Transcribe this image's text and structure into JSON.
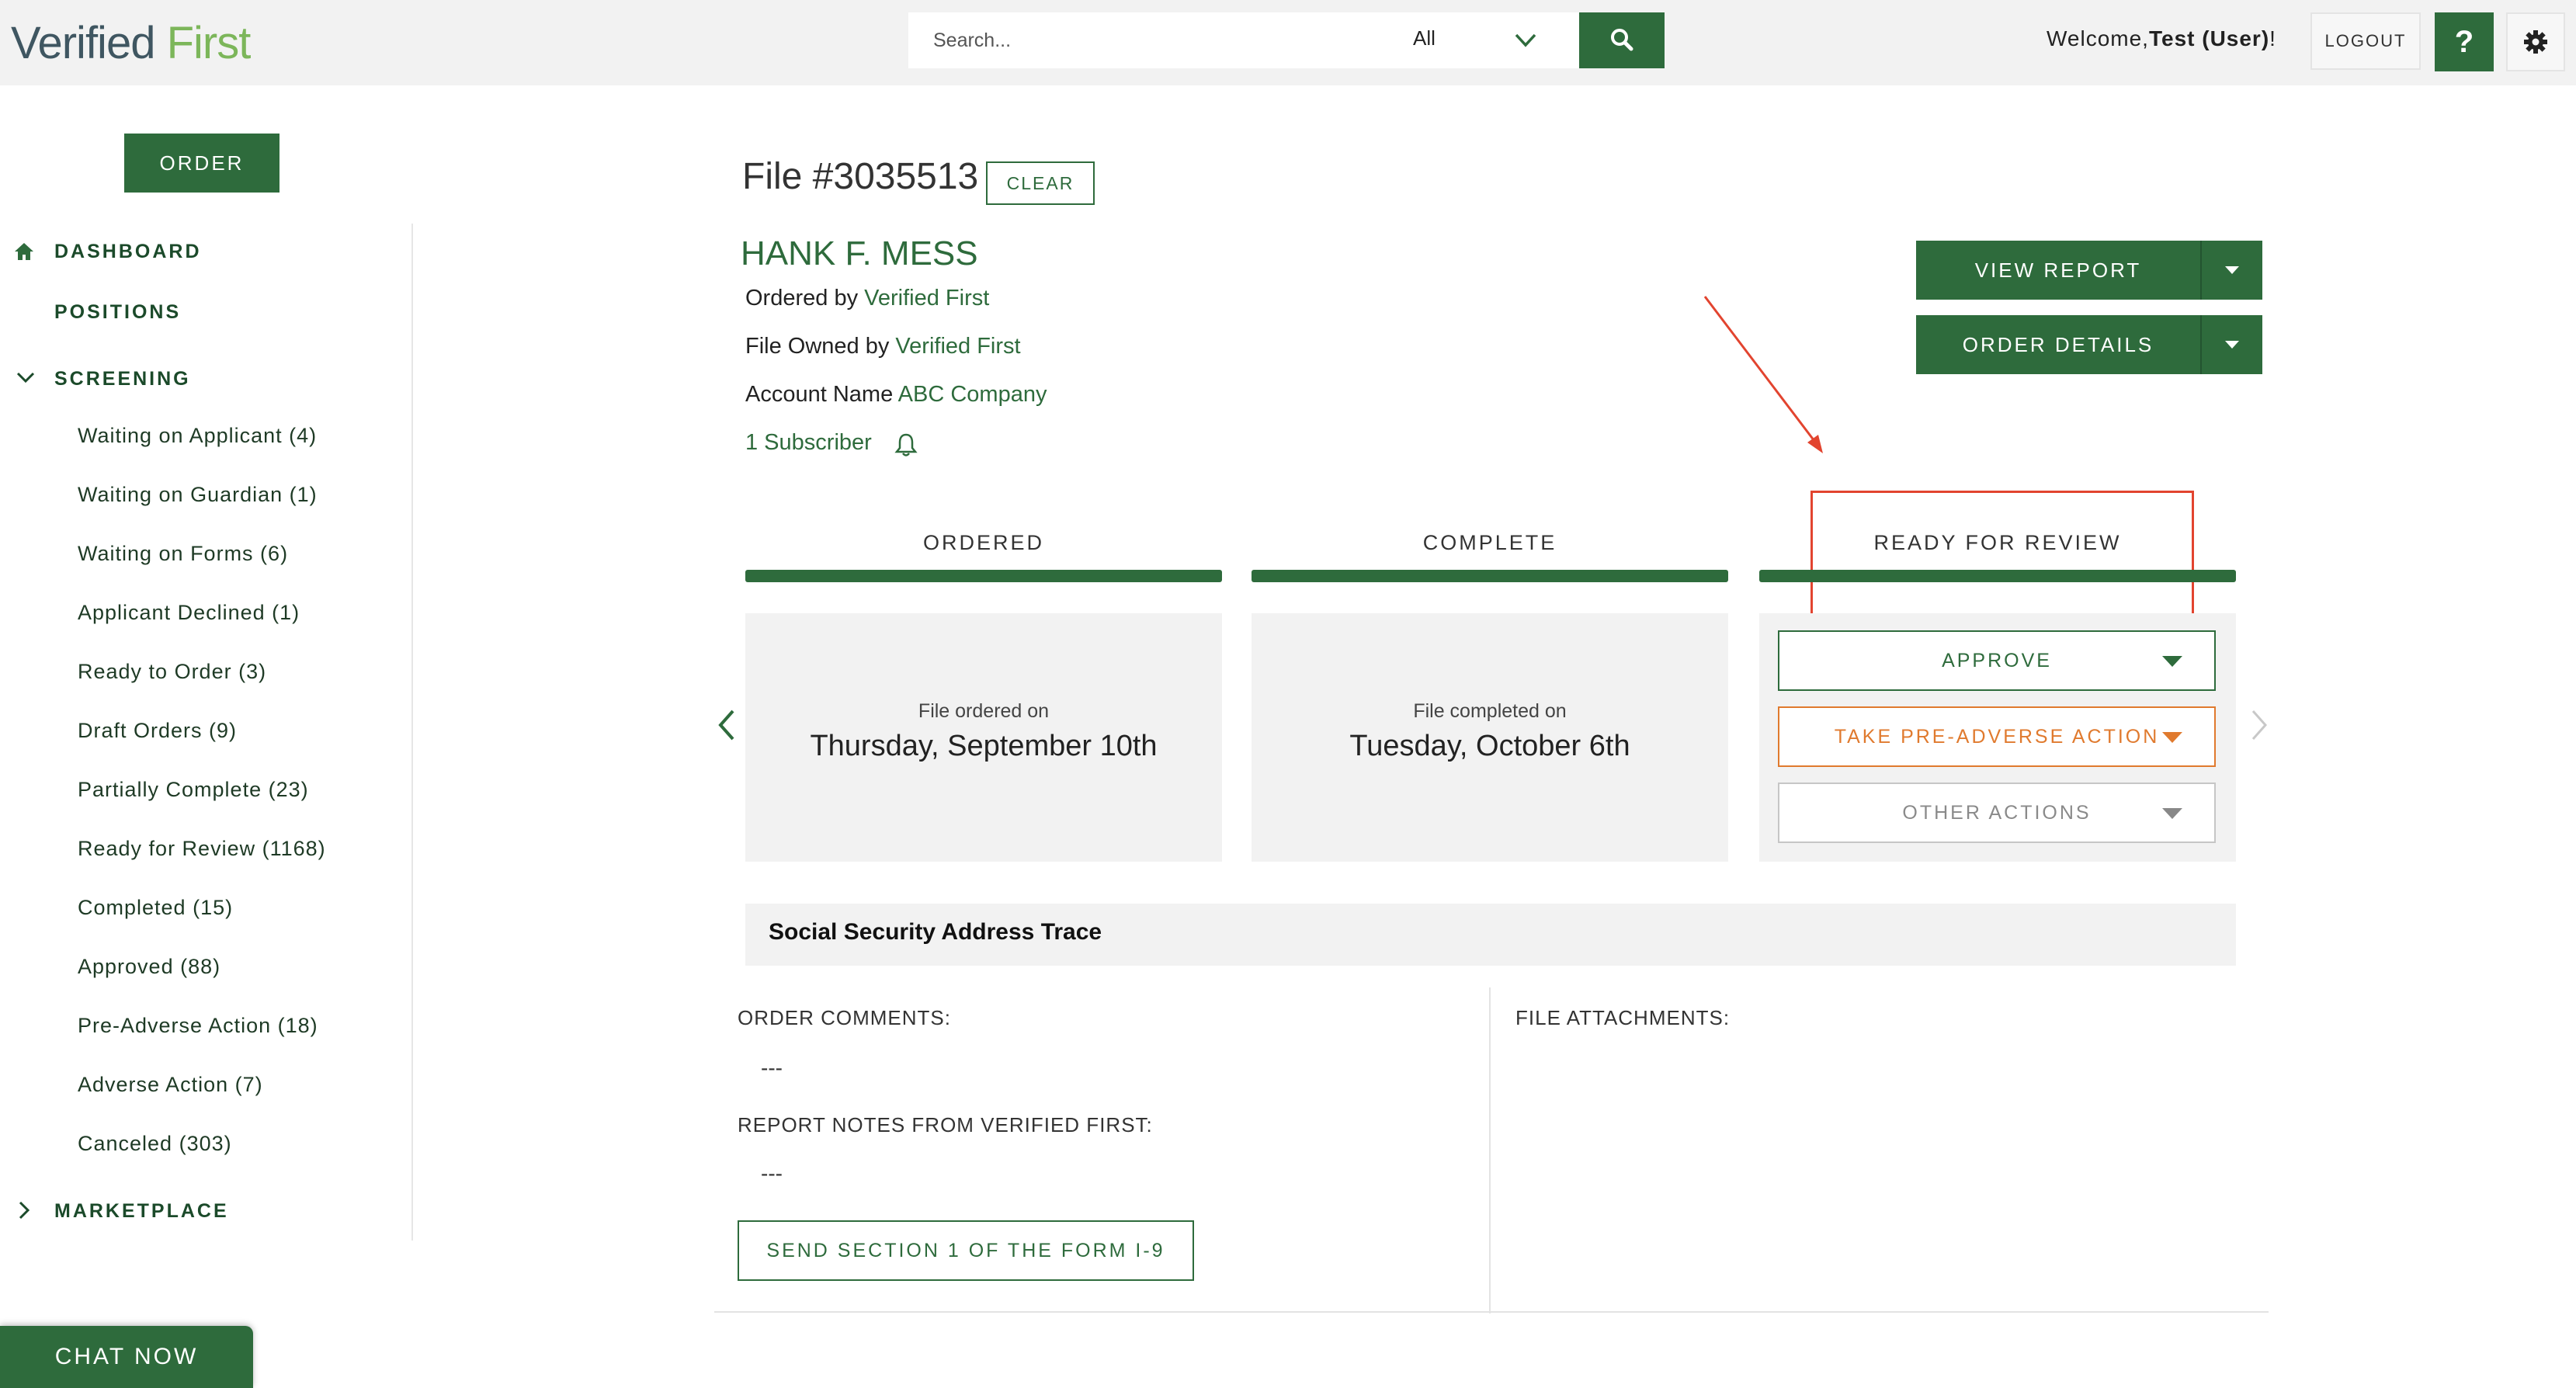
{
  "header": {
    "logo_part1": "Verified",
    "logo_part2": "First",
    "search_placeholder": "Search...",
    "search_scope": "All",
    "welcome_prefix": "Welcome,",
    "welcome_user": "Test (User)",
    "welcome_suffix": "!",
    "logout_label": "LOGOUT",
    "help_label": "?"
  },
  "sidebar": {
    "order_label": "ORDER",
    "dashboard_label": "DASHBOARD",
    "positions_label": "POSITIONS",
    "screening_label": "SCREENING",
    "screening_items": [
      "Waiting on Applicant (4)",
      "Waiting on Guardian (1)",
      "Waiting on Forms (6)",
      "Applicant Declined (1)",
      "Ready to Order (3)",
      "Draft Orders (9)",
      "Partially Complete (23)",
      "Ready for Review (1168)",
      "Completed (15)",
      "Approved (88)",
      "Pre-Adverse Action (18)",
      "Adverse Action (7)",
      "Canceled (303)"
    ],
    "marketplace_label": "MARKETPLACE",
    "chat_label": "CHAT NOW"
  },
  "file": {
    "title": "File #3035513",
    "clear_label": "CLEAR",
    "applicant_name": "HANK F. MESS",
    "ordered_by_label": "Ordered by",
    "ordered_by_value": "Verified First",
    "owned_by_label": "File Owned by",
    "owned_by_value": "Verified First",
    "account_label": "Account Name",
    "account_value": "ABC Company",
    "subscriber_text": "1 Subscriber"
  },
  "actions": {
    "view_report_label": "VIEW REPORT",
    "order_details_label": "ORDER DETAILS"
  },
  "stages": [
    {
      "label": "ORDERED",
      "small": "File ordered on",
      "date": "Thursday, September 10th"
    },
    {
      "label": "COMPLETE",
      "small": "File completed on",
      "date": "Tuesday, October 6th"
    },
    {
      "label": "READY FOR REVIEW"
    }
  ],
  "review_actions": {
    "approve_label": "APPROVE",
    "pre_adverse_label": "TAKE PRE-ADVERSE ACTION",
    "other_label": "OTHER ACTIONS"
  },
  "details": {
    "section_title": "Social Security Address Trace",
    "order_comments_label": "ORDER COMMENTS:",
    "order_comments_value": "---",
    "report_notes_label": "REPORT NOTES FROM VERIFIED FIRST:",
    "report_notes_value": "---",
    "file_attachments_label": "FILE ATTACHMENTS:",
    "i9_label": "SEND SECTION 1 OF THE FORM I-9"
  },
  "colors": {
    "brand_green": "#2e6b3c",
    "logo_green": "#7cb65a",
    "warning_orange": "#e07a2e",
    "annotation_red": "#e2442f"
  }
}
